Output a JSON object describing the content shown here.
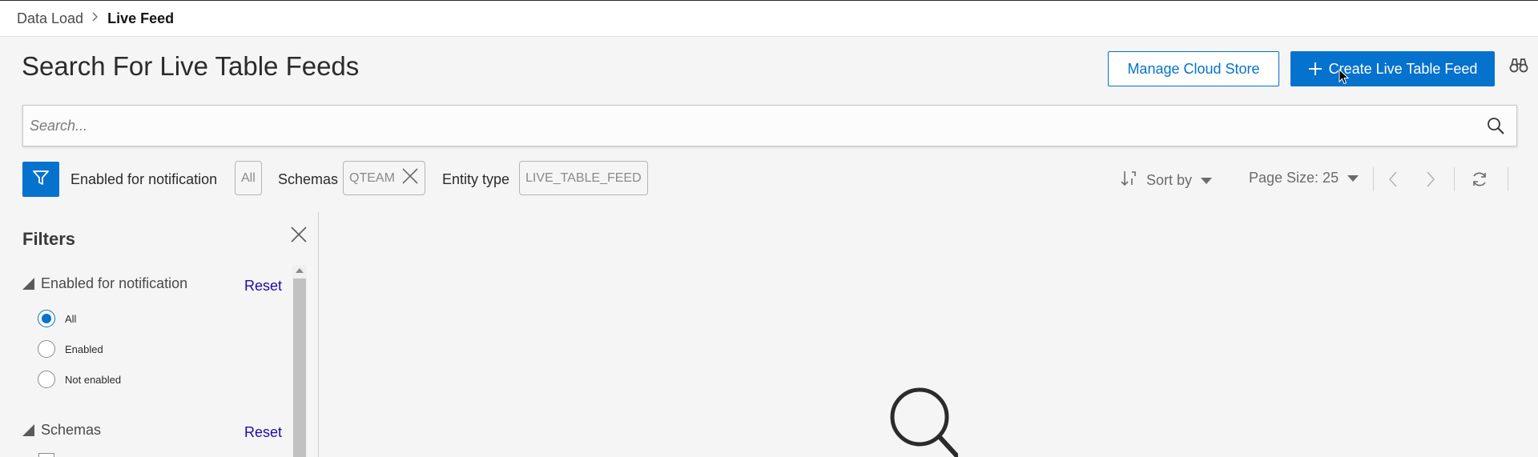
{
  "breadcrumb": {
    "parent": "Data Load",
    "current": "Live Feed"
  },
  "page": {
    "title": "Search For Live Table Feeds"
  },
  "actions": {
    "manage_cloud_store": "Manage Cloud Store",
    "create_live_table_feed": "Create Live Table Feed"
  },
  "search": {
    "placeholder": "Search..."
  },
  "filter_bar": {
    "notification_label": "Enabled for notification",
    "notification_value": "All",
    "schemas_label": "Schemas",
    "schemas_value": "QTEAM",
    "entity_type_label": "Entity type",
    "entity_type_value": "LIVE_TABLE_FEED",
    "sort_label": "Sort by",
    "page_size_label": "Page Size: 25"
  },
  "filters_panel": {
    "title": "Filters",
    "facets": [
      {
        "name": "Enabled for notification",
        "reset_label": "Reset",
        "options": [
          {
            "label": "All",
            "checked": true
          },
          {
            "label": "Enabled",
            "checked": false
          },
          {
            "label": "Not enabled",
            "checked": false
          }
        ]
      },
      {
        "name": "Schemas",
        "reset_label": "Reset"
      }
    ]
  },
  "colors": {
    "primary": "#0572ce",
    "link": "#1a0dab",
    "background": "#f5f5f5"
  },
  "icons": [
    "chevron-right-icon",
    "plus-icon",
    "binoculars-icon",
    "search-icon",
    "filter-icon",
    "close-icon",
    "sort-icon",
    "caret-down-icon",
    "chevron-left-icon",
    "refresh-icon"
  ]
}
